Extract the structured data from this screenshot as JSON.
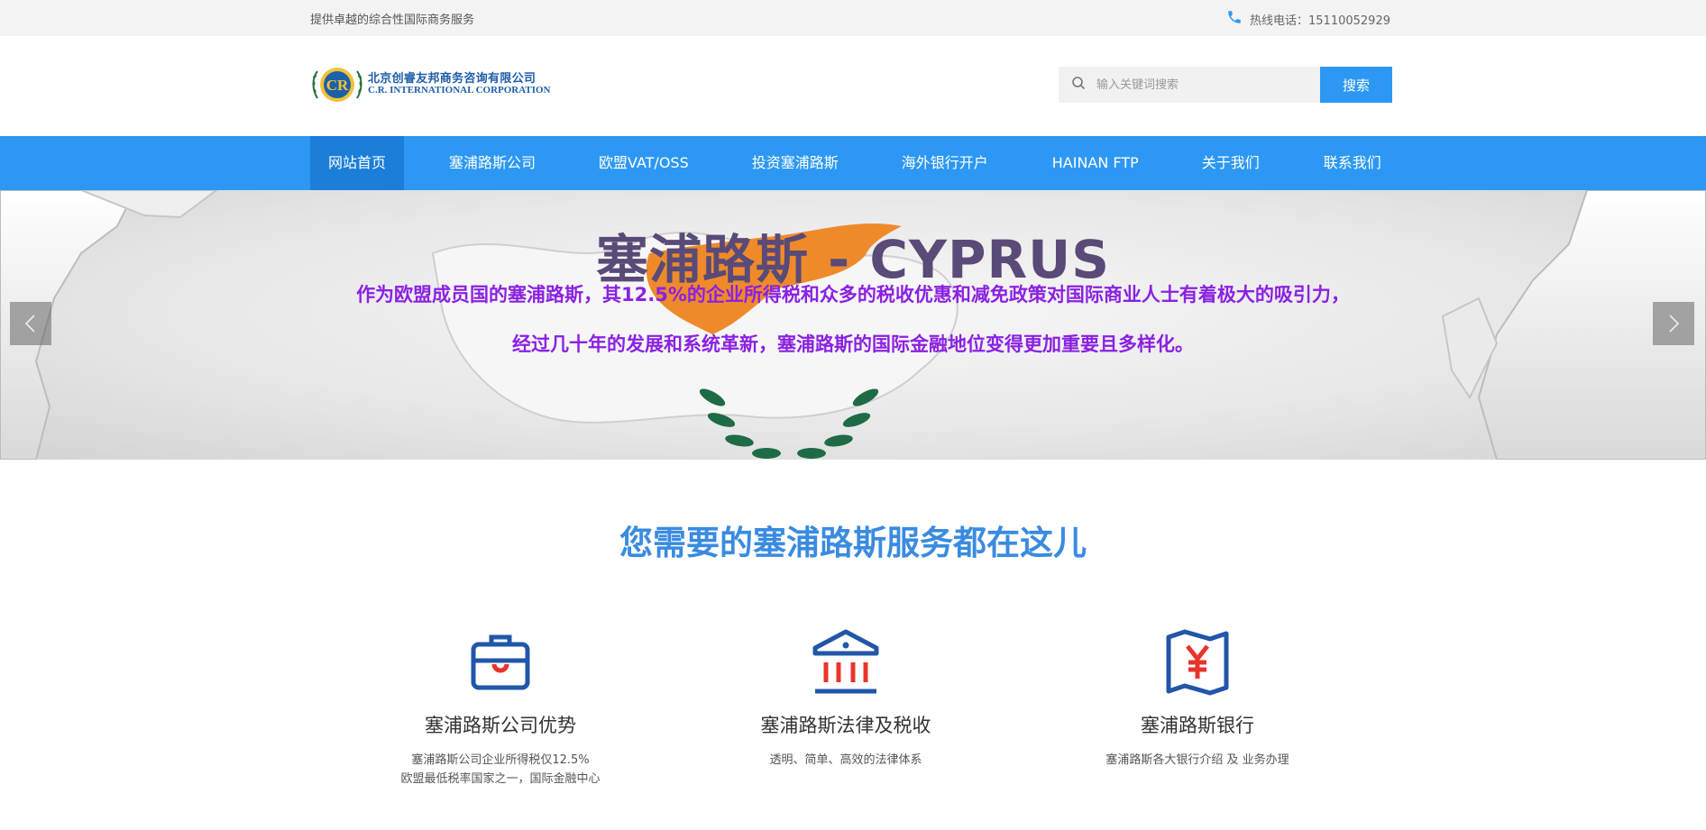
{
  "topbar": {
    "tagline": "提供卓越的综合性国际商务服务",
    "hotline_label": "热线电话：",
    "hotline_number": "15110052929",
    "phone_icon": "phone-icon"
  },
  "header": {
    "logo_name_cn": "北京创睿友邦商务咨询有限公司",
    "logo_name_en": "C.R. INTERNATIONAL CORPORATION",
    "logo_mark_letters": "CR",
    "search_placeholder": "输入关键词搜索",
    "search_button": "搜索",
    "search_icon": "search-icon"
  },
  "nav": {
    "items": [
      {
        "label": "网站首页",
        "active": true
      },
      {
        "label": "塞浦路斯公司",
        "active": false
      },
      {
        "label": "欧盟VAT/OSS",
        "active": false
      },
      {
        "label": "投资塞浦路斯",
        "active": false
      },
      {
        "label": "海外银行开户",
        "active": false
      },
      {
        "label": "HAINAN FTP",
        "active": false
      },
      {
        "label": "关于我们",
        "active": false
      },
      {
        "label": "联系我们",
        "active": false
      }
    ]
  },
  "banner": {
    "title": "塞浦路斯 - CYPRUS",
    "line1": "作为欧盟成员国的塞浦路斯，其12.5%的企业所得税和众多的税收优惠和减免政策对国际商业人士有着极大的吸引力，",
    "line2": "经过几十年的发展和系统革新，塞浦路斯的国际金融地位变得更加重要且多样化。",
    "prev_icon": "chevron-left-icon",
    "next_icon": "chevron-right-icon"
  },
  "services": {
    "section_title": "您需要的塞浦路斯服务都在这儿",
    "items": [
      {
        "icon": "briefcase-icon",
        "name": "塞浦路斯公司优势",
        "desc_line1": "塞浦路斯公司企业所得税仅12.5%",
        "desc_line2": "欧盟最低税率国家之一，国际金融中心"
      },
      {
        "icon": "bank-icon",
        "name": "塞浦路斯法律及税收",
        "desc_line1": "透明、简单、高效的法律体系",
        "desc_line2": ""
      },
      {
        "icon": "yuan-map-icon",
        "name": "塞浦路斯银行",
        "desc_line1": "塞浦路斯各大银行介绍 及 业务办理",
        "desc_line2": ""
      }
    ]
  },
  "colors": {
    "brand_blue": "#2d98f3",
    "nav_active": "#1b7ed8",
    "title_purple": "#5a4a78",
    "banner_text": "#8b21e2",
    "section_title": "#3a8be0",
    "icon_blue": "#2156a8",
    "icon_red": "#e8342a"
  }
}
